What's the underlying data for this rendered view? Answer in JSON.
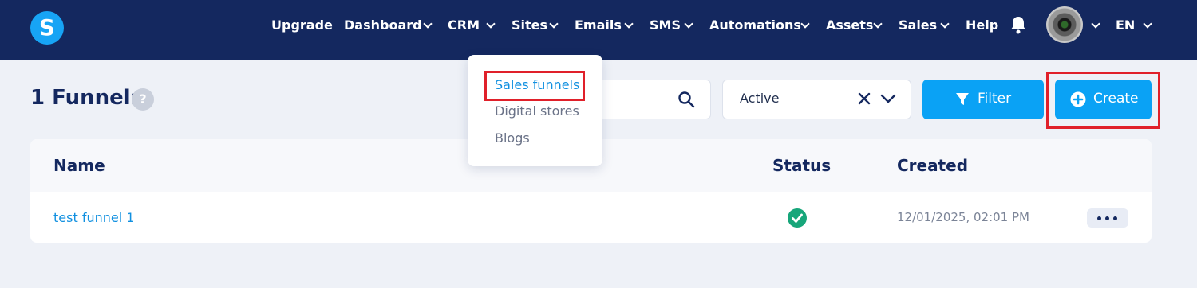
{
  "app": {
    "logo_letter": "S"
  },
  "nav": {
    "items": [
      {
        "label": "Upgrade"
      },
      {
        "label": "Dashboard"
      },
      {
        "label": "CRM"
      },
      {
        "label": "Sites"
      },
      {
        "label": "Emails"
      },
      {
        "label": "SMS"
      },
      {
        "label": "Automations"
      },
      {
        "label": "Assets"
      },
      {
        "label": "Sales"
      },
      {
        "label": "Help"
      }
    ],
    "language": "EN"
  },
  "sites_menu": {
    "items": [
      {
        "label": "Sales funnels",
        "highlighted": true
      },
      {
        "label": "Digital stores"
      },
      {
        "label": "Blogs"
      }
    ]
  },
  "page": {
    "title": "1 Funnels",
    "help_icon": "?"
  },
  "filters": {
    "status_value": "Active",
    "filter_label": "Filter",
    "create_label": "Create"
  },
  "table": {
    "columns": [
      "Name",
      "Status",
      "Created"
    ],
    "rows": [
      {
        "name": "test funnel 1",
        "status": "active",
        "created": "12/01/2025, 02:01 PM"
      }
    ]
  },
  "colors": {
    "nav_bg": "#14285f",
    "accent": "#0aa2f5",
    "highlight_border": "#e0202a",
    "status_active": "#17a67a"
  }
}
